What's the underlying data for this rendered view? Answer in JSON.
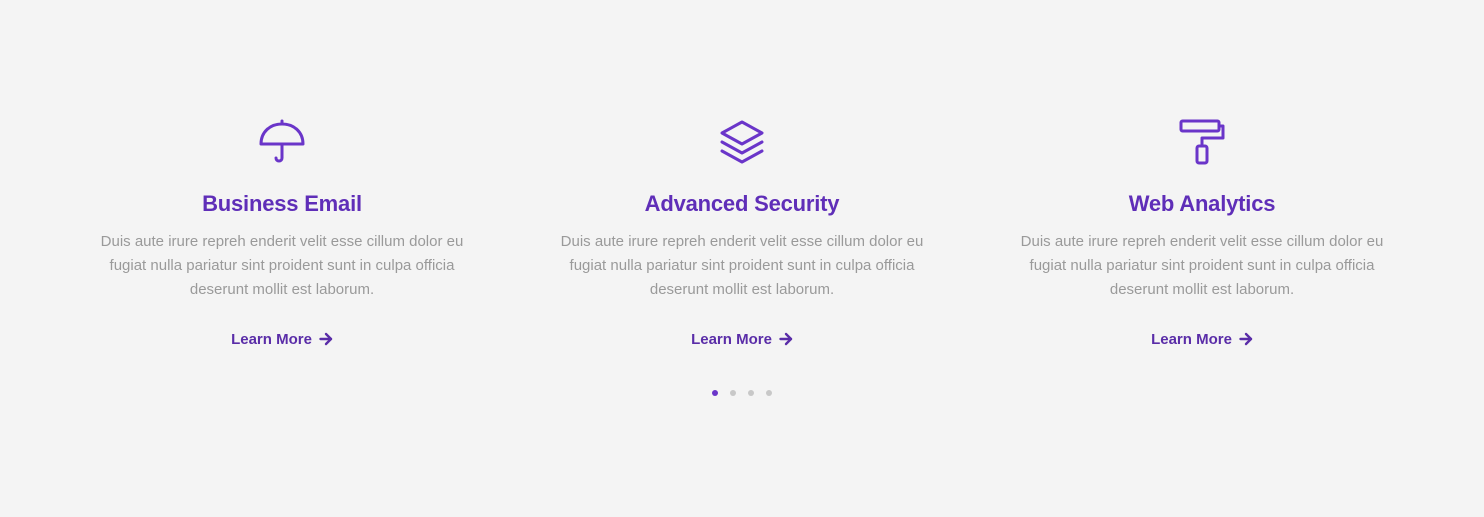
{
  "accent_color": "#6a35c9",
  "features": [
    {
      "icon": "umbrella-icon",
      "title": "Business Email",
      "description": "Duis aute irure repreh enderit velit esse cillum dolor eu fugiat nulla pariatur sint proident sunt in culpa officia deserunt mollit est laborum.",
      "link_label": "Learn More"
    },
    {
      "icon": "layers-icon",
      "title": "Advanced Security",
      "description": "Duis aute irure repreh enderit velit esse cillum dolor eu fugiat nulla pariatur sint proident sunt in culpa officia deserunt mollit est laborum.",
      "link_label": "Learn More"
    },
    {
      "icon": "paint-roller-icon",
      "title": "Web Analytics",
      "description": "Duis aute irure repreh enderit velit esse cillum dolor eu fugiat nulla pariatur sint proident sunt in culpa officia deserunt mollit est laborum.",
      "link_label": "Learn More"
    }
  ],
  "carousel": {
    "total_pages": 4,
    "active_page": 1
  }
}
